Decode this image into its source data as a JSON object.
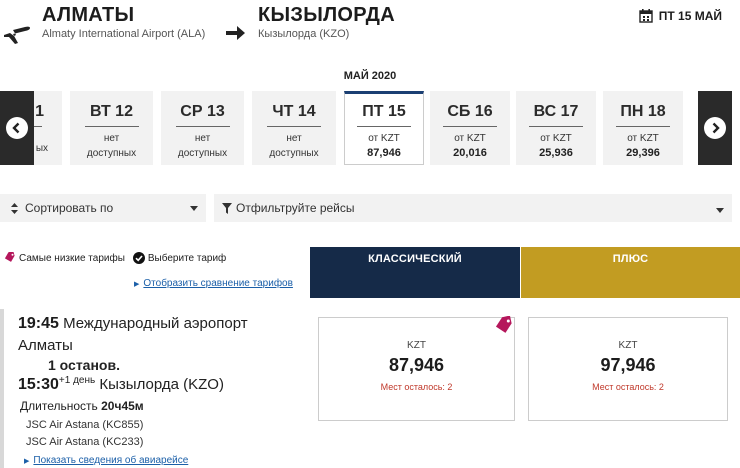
{
  "header": {
    "from_code": "АЛМАТЫ",
    "from_airport": "Almaty International Airport (ALA)",
    "to_code": "КЫЗЫЛОРДА",
    "to_airport": "Кызылорда (KZO)",
    "date": "ПТ 15 МАЙ"
  },
  "calendar": {
    "month": "МАЙ 2020",
    "days": [
      {
        "name": "1",
        "line1": "ых",
        "line2": "",
        "price": ""
      },
      {
        "name": "ВТ 12",
        "line1": "нет",
        "line2": "доступных",
        "price": ""
      },
      {
        "name": "СР 13",
        "line1": "нет",
        "line2": "доступных",
        "price": ""
      },
      {
        "name": "ЧТ 14",
        "line1": "нет",
        "line2": "доступных",
        "price": ""
      },
      {
        "name": "ПТ 15",
        "line1": "от KZT",
        "line2": "",
        "price": "87,946"
      },
      {
        "name": "СБ 16",
        "line1": "от KZT",
        "line2": "",
        "price": "20,016"
      },
      {
        "name": "ВС 17",
        "line1": "от KZT",
        "line2": "",
        "price": "25,936"
      },
      {
        "name": "ПН 18",
        "line1": "от KZT",
        "line2": "",
        "price": "29,396"
      }
    ]
  },
  "filters": {
    "sort_label": "Сортировать по",
    "filter_label": "Отфильтруйте рейсы"
  },
  "legend": {
    "lowest": "Самые низкие тарифы",
    "choose": "Выберите тариф",
    "compare_link": "Отобразить сравнение тарифов"
  },
  "fares": {
    "classic": "КЛАССИЧЕСКИЙ",
    "plus": "ПЛЮС"
  },
  "flight": {
    "dep_time": "19:45",
    "dep_airport_1": "Международный аэропорт",
    "dep_airport_2": "Алматы",
    "stops": "1 останов.",
    "arr_time": "15:30",
    "arr_day": "+1 день",
    "arr_airport": "Кызылорда (KZO)",
    "duration_label": "Длительность",
    "duration_value": "20ч45м",
    "carrier_1": "JSC Air Astana (KC855)",
    "carrier_2": "JSC Air Astana (KC233)",
    "details_link": "Показать сведения об авиарейсе"
  },
  "prices": {
    "classic": {
      "currency": "KZT",
      "amount": "87,946",
      "seats": "Мест осталось: 2"
    },
    "plus": {
      "currency": "KZT",
      "amount": "97,946",
      "seats": "Мест осталось: 2"
    }
  },
  "colors": {
    "classic_bg": "#152a48",
    "plus_bg": "#c29c22",
    "tag": "#b5175c",
    "link": "#1b5fa8",
    "seats": "#c0392b"
  }
}
